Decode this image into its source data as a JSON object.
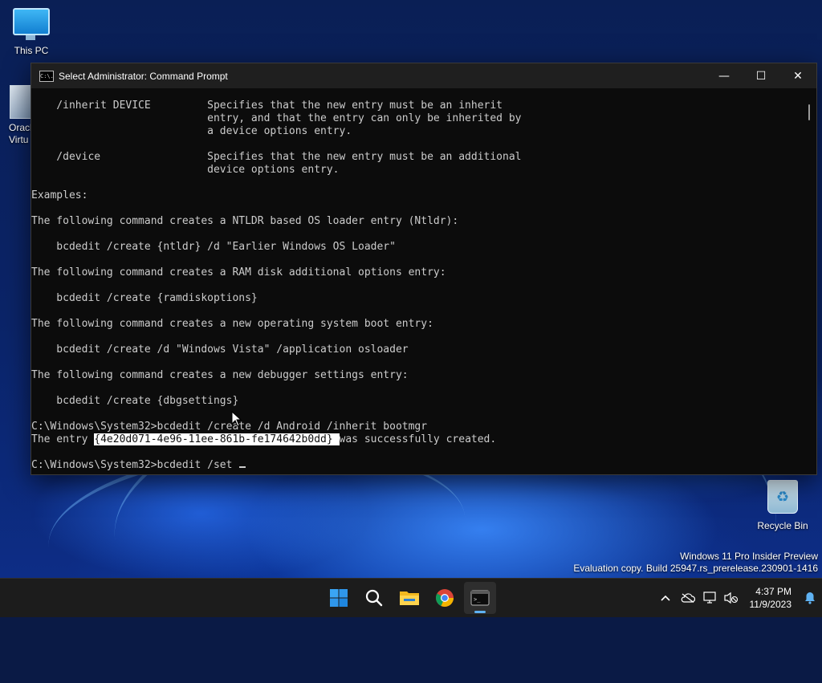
{
  "desktop": {
    "icons": [
      {
        "label": "This PC"
      },
      {
        "label": "Oracl\nVirtu"
      },
      {
        "label": "Recycle Bin"
      }
    ],
    "watermark": {
      "line1": "Windows 11 Pro Insider Preview",
      "line2": "Evaluation copy. Build 25947.rs_prerelease.230901-1416"
    }
  },
  "window": {
    "title": "Select Administrator: Command Prompt",
    "icon_text": "C:\\.",
    "controls": {
      "minimize": "—",
      "maximize": "☐",
      "close": "✕"
    },
    "console_lines": [
      "    /inherit DEVICE         Specifies that the new entry must be an inherit",
      "                            entry, and that the entry can only be inherited by",
      "                            a device options entry.",
      "",
      "    /device                 Specifies that the new entry must be an additional",
      "                            device options entry.",
      "",
      "Examples:",
      "",
      "The following command creates a NTLDR based OS loader entry (Ntldr):",
      "",
      "    bcdedit /create {ntldr} /d \"Earlier Windows OS Loader\"",
      "",
      "The following command creates a RAM disk additional options entry:",
      "",
      "    bcdedit /create {ramdiskoptions}",
      "",
      "The following command creates a new operating system boot entry:",
      "",
      "    bcdedit /create /d \"Windows Vista\" /application osloader",
      "",
      "The following command creates a new debugger settings entry:",
      "",
      "    bcdedit /create {dbgsettings}",
      "",
      "C:\\Windows\\System32>bcdedit /create /d Android /inherit bootmgr"
    ],
    "entry_line": {
      "prefix": "The entry ",
      "highlight": "{4e20d071-4e96-11ee-861b-fe174642b0dd} ",
      "suffix": "was successfully created."
    },
    "prompt_line": "C:\\Windows\\System32>bcdedit /set "
  },
  "taskbar": {
    "apps": [
      {
        "name": "start",
        "icon": "windows-logo"
      },
      {
        "name": "search",
        "icon": "search-icon"
      },
      {
        "name": "file-explorer",
        "icon": "folder-icon"
      },
      {
        "name": "chrome",
        "icon": "chrome-icon"
      },
      {
        "name": "terminal",
        "icon": "terminal-icon",
        "active": true
      }
    ],
    "tray": {
      "time": "4:37 PM",
      "date": "11/9/2023"
    }
  }
}
